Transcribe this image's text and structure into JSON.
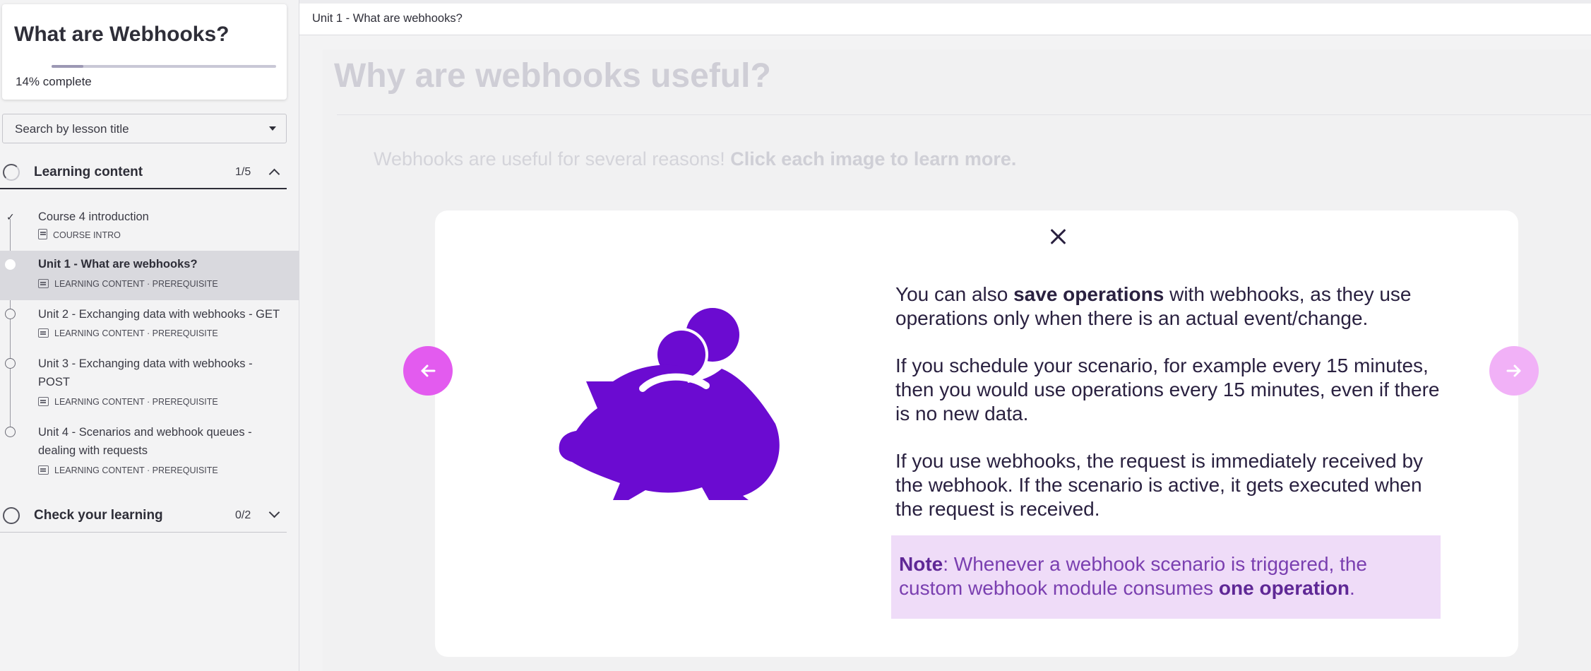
{
  "sidebar": {
    "course_title": "What are Webhooks?",
    "progress_percent": 14,
    "progress_value": "14%",
    "progress_suffix": "complete",
    "search_placeholder": "Search by lesson title",
    "sections": [
      {
        "title": "Learning content",
        "count": "1/5",
        "expanded": true
      },
      {
        "title": "Check your learning",
        "count": "0/2",
        "expanded": false
      }
    ],
    "lessons": [
      {
        "title": "Course 4 introduction",
        "meta": "COURSE INTRO",
        "status": "completed"
      },
      {
        "title": "Unit 1 - What are webhooks?",
        "meta": "LEARNING CONTENT · PREREQUISITE",
        "status": "active"
      },
      {
        "title": "Unit 2 - Exchanging data with webhooks - GET",
        "meta": "LEARNING CONTENT · PREREQUISITE",
        "status": "not-started"
      },
      {
        "title": "Unit 3 - Exchanging data with webhooks - POST",
        "meta": "LEARNING CONTENT · PREREQUISITE",
        "status": "not-started"
      },
      {
        "title": "Unit 4 - Scenarios and webhook queues - dealing with requests",
        "meta": "LEARNING CONTENT · PREREQUISITE",
        "status": "not-started"
      }
    ]
  },
  "topbar": {
    "title": "Unit 1 - What are webhooks?"
  },
  "main": {
    "heading": "Why are webhooks useful?",
    "intro_plain": "Webhooks are useful for several reasons! ",
    "intro_bold": "Click each image to learn more."
  },
  "modal": {
    "image_icon": "piggy-bank-icon",
    "p1_a": "You can also ",
    "p1_bold": "save operations",
    "p1_b": " with webhooks, as they use operations only when there is an actual event/change.",
    "p2": "If you schedule your scenario, for example every 15 minutes, then you would use operations every 15 minutes, even if there is no new data.",
    "p3": "If you use webhooks, the request is immediately received by the webhook. If the scenario is active, it gets executed when the request is received.",
    "note_label": "Note",
    "note_a": ": Whenever a webhook scenario is triggered, the custom webhook module consumes ",
    "note_bold": "one operation",
    "note_b": "."
  },
  "colors": {
    "accent": "#e35bef",
    "accent_disabled": "#f1b1f7",
    "illustration": "#6b0bd1",
    "note_bg": "#efdcf8",
    "text_dark": "#2a2140"
  }
}
